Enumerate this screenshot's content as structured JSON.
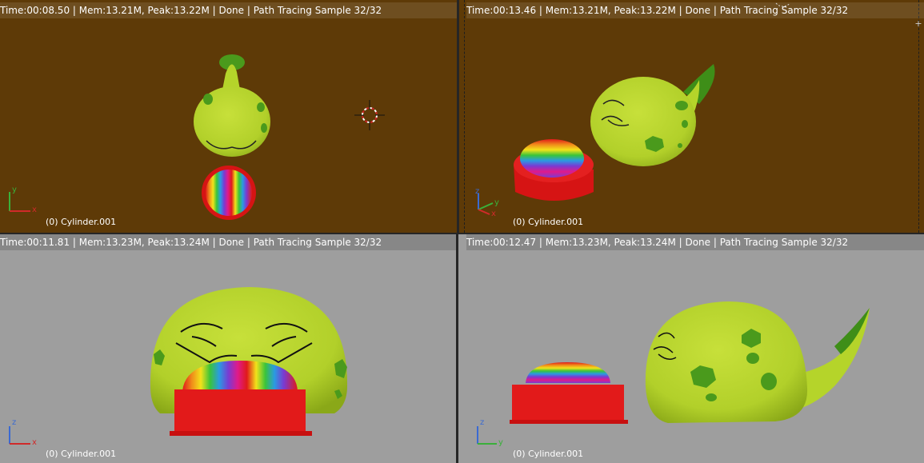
{
  "colors": {
    "background_brown": "#5e3a07",
    "background_gray": "#9e9e9e",
    "body_green": "#b5d42a",
    "spot_green": "#4a9a1c",
    "bowl_red": "#e21a1a",
    "text": "#ffffff"
  },
  "viewports": [
    {
      "stats": "Time:00:08.50 | Mem:13.21M, Peak:13.22M | Done | Path Tracing Sample 32/32",
      "object_label": "(0) Cylinder.001",
      "axes": [
        "y",
        "x"
      ]
    },
    {
      "stats": "Time:00:13.46 | Mem:13.21M, Peak:13.22M | Done | Path Tracing Sample 32/32",
      "object_label": "(0) Cylinder.001",
      "axes": [
        "z",
        "y",
        "x"
      ]
    },
    {
      "stats": "Time:00:11.81 | Mem:13.23M, Peak:13.24M | Done | Path Tracing Sample 32/32",
      "object_label": "(0) Cylinder.001",
      "axes": [
        "z",
        "x"
      ]
    },
    {
      "stats": "Time:00:12.47 | Mem:13.23M, Peak:13.24M | Done | Path Tracing Sample 32/32",
      "object_label": "(0) Cylinder.001",
      "axes": [
        "z",
        "y"
      ]
    }
  ],
  "icons": {
    "viewport_corner": "plus-icon",
    "cursor": "3d-cursor-icon"
  },
  "corner_plus_text": "+"
}
